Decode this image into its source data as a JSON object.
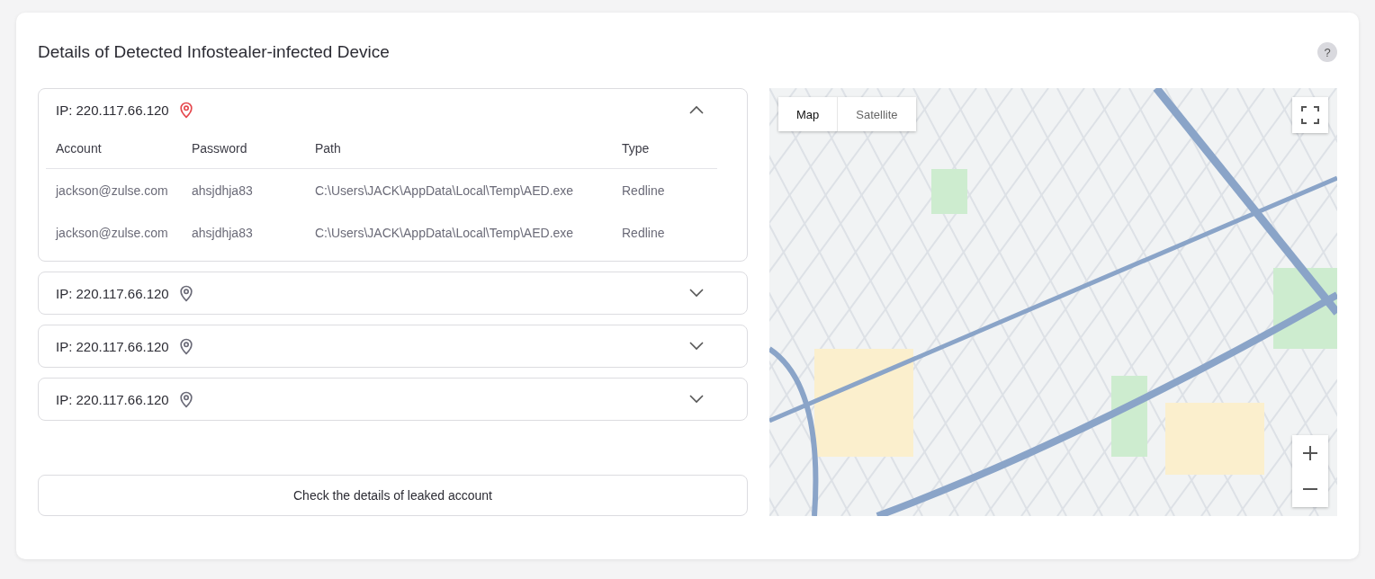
{
  "title": "Details of Detected Infostealer-infected Device",
  "help": "?",
  "devices": [
    {
      "label": "IP: 220.117.66.120",
      "expanded": true,
      "columns": [
        "Account",
        "Password",
        "Path",
        "Type"
      ],
      "rows": [
        [
          "jackson@zulse.com",
          "ahsjdhja83",
          "C:\\Users\\JACK\\AppData\\Local\\Temp\\AED.exe",
          "Redline"
        ],
        [
          "jackson@zulse.com",
          "ahsjdhja83",
          "C:\\Users\\JACK\\AppData\\Local\\Temp\\AED.exe",
          "Redline"
        ]
      ]
    },
    {
      "label": "IP: 220.117.66.120",
      "expanded": false
    },
    {
      "label": "IP: 220.117.66.120",
      "expanded": false
    },
    {
      "label": "IP: 220.117.66.120",
      "expanded": false
    }
  ],
  "action_button": "Check the details of leaked account",
  "map": {
    "view_tabs": [
      {
        "label": "Map",
        "selected": true
      },
      {
        "label": "Satellite",
        "selected": false
      }
    ]
  }
}
